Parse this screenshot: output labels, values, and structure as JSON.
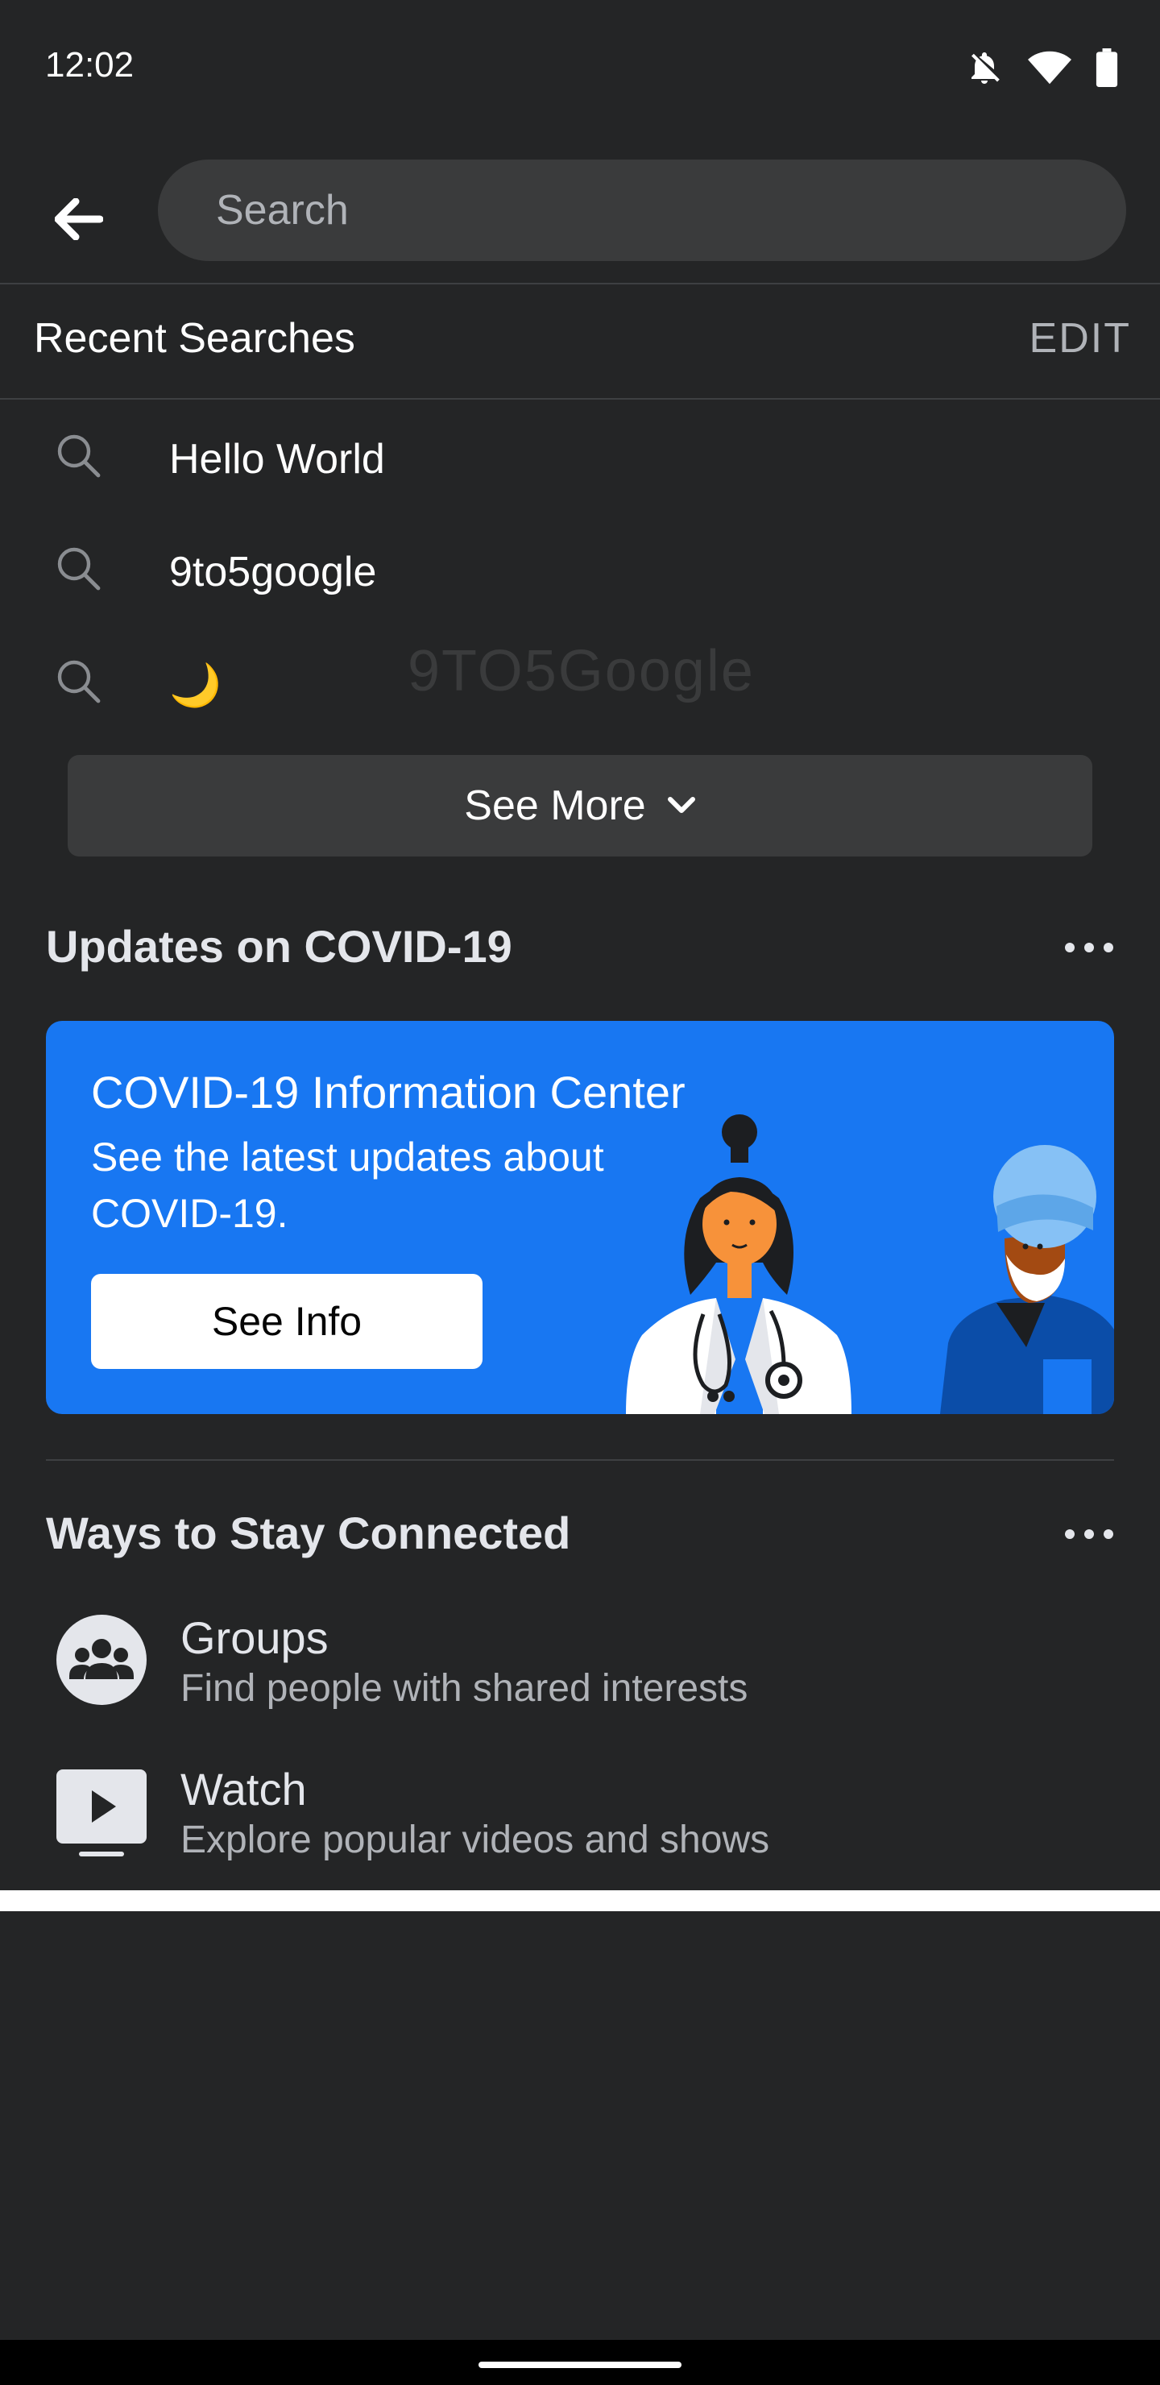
{
  "status_bar": {
    "time": "12:02",
    "icons": [
      "bell-off-icon",
      "wifi-icon",
      "battery-icon"
    ]
  },
  "header": {
    "search_placeholder": "Search",
    "back_icon": "arrow-left-icon"
  },
  "recent_searches": {
    "title": "Recent Searches",
    "edit_label": "EDIT",
    "items": [
      {
        "label": "Hello World"
      },
      {
        "label": "9to5google"
      },
      {
        "label": "🌙"
      }
    ],
    "see_more_label": "See More",
    "watermark": "9TO5Google"
  },
  "covid_section": {
    "title": "Updates on COVID-19",
    "card": {
      "title": "COVID-19 Information Center",
      "subtitle": "See the latest updates about COVID-19.",
      "button_label": "See Info",
      "accent_color": "#1877f2"
    }
  },
  "connect_section": {
    "title": "Ways to Stay Connected",
    "items": [
      {
        "title": "Groups",
        "subtitle": "Find people with shared interests",
        "icon": "groups-icon"
      },
      {
        "title": "Watch",
        "subtitle": "Explore popular videos and shows",
        "icon": "watch-icon"
      }
    ]
  },
  "colors": {
    "background": "#242526",
    "surface": "#3a3b3c",
    "text_primary": "#e4e6eb",
    "text_secondary": "#b0b3b8"
  }
}
